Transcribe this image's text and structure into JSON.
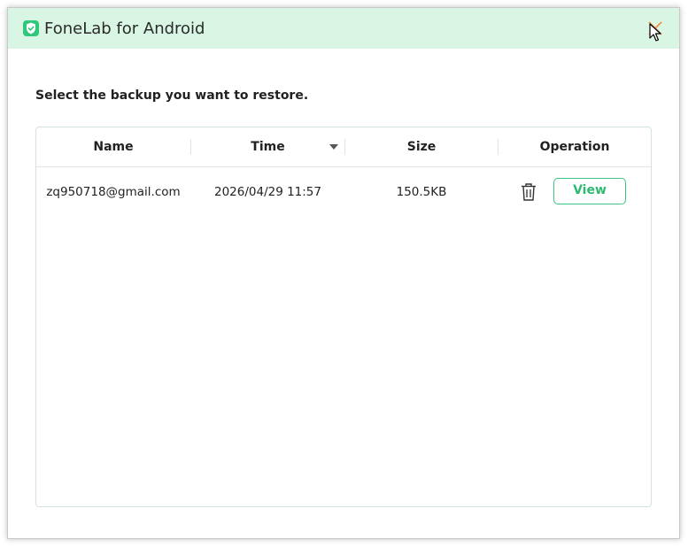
{
  "window": {
    "title": "FoneLab for Android",
    "close_icon": "close-icon",
    "logo_icon": "shield-check-icon"
  },
  "instruction": "Select the backup you want to restore.",
  "table": {
    "columns": [
      {
        "label": "Name"
      },
      {
        "label": "Time",
        "sort": "descending"
      },
      {
        "label": "Size"
      },
      {
        "label": "Operation"
      }
    ],
    "rows": [
      {
        "name": "zq950718@gmail.com",
        "time": "2026/04/29 11:57",
        "size": "150.5KB",
        "delete_icon": "trash-icon",
        "view_label": "View"
      }
    ]
  },
  "colors": {
    "accent": "#2fc77a",
    "titlebar": "#d9f5e3",
    "close": "#f28b3c"
  }
}
